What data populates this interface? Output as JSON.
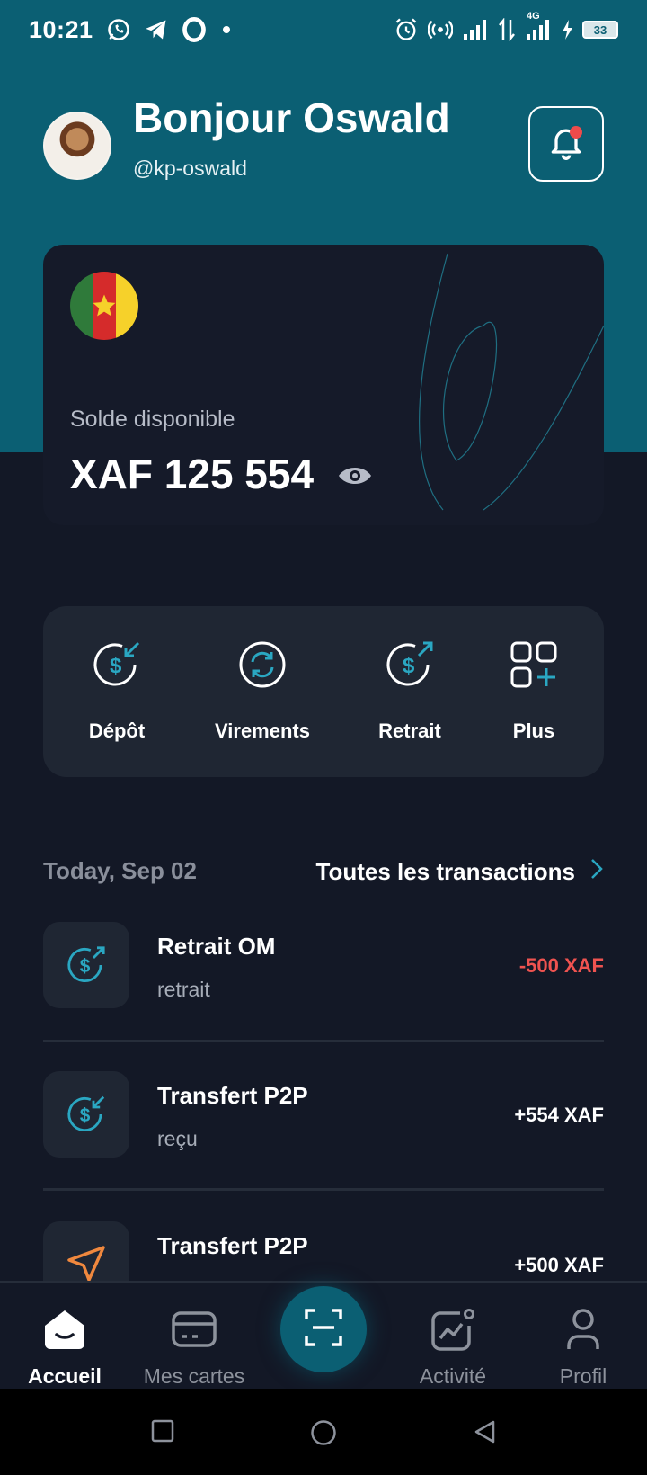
{
  "status_bar": {
    "time": "10:21",
    "battery": "33",
    "network": "4G"
  },
  "header": {
    "greeting": "Bonjour Oswald",
    "handle": "@kp-oswald"
  },
  "balance": {
    "label": "Solde disponible",
    "amount": "XAF 125 554"
  },
  "actions": [
    {
      "label": "Dépôt",
      "icon": "deposit-icon"
    },
    {
      "label": "Virements",
      "icon": "transfer-icon"
    },
    {
      "label": "Retrait",
      "icon": "withdraw-icon"
    },
    {
      "label": "Plus",
      "icon": "grid-plus-icon"
    }
  ],
  "transactions": {
    "date": "Today, Sep 02",
    "see_all": "Toutes les transactions",
    "items": [
      {
        "title": "Retrait OM",
        "subtitle": "retrait",
        "amount": "-500 XAF",
        "icon": "withdraw-icon"
      },
      {
        "title": "Transfert P2P",
        "subtitle": "reçu",
        "amount": "+554 XAF",
        "icon": "deposit-icon"
      },
      {
        "title": "Transfert P2P",
        "subtitle": "",
        "amount": "+500 XAF",
        "icon": "send-icon"
      }
    ]
  },
  "nav": [
    {
      "label": "Accueil",
      "icon": "home-icon",
      "active": true
    },
    {
      "label": "Mes cartes",
      "icon": "card-icon"
    },
    {
      "label": "Activité",
      "icon": "activity-icon"
    },
    {
      "label": "Profil",
      "icon": "profile-icon"
    }
  ],
  "colors": {
    "teal": "#0b5f73",
    "background": "#131826",
    "card": "#1f2633",
    "accent": "#2aa7c2",
    "negative": "#ef5350",
    "orange": "#f0883e"
  }
}
